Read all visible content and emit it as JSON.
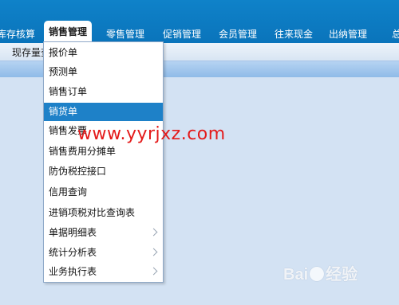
{
  "topnav": {
    "items": [
      "库存核算",
      "销售管理",
      "零售管理",
      "促销管理",
      "会员管理",
      "往来现金",
      "出纳管理",
      "总"
    ],
    "active": "销售管理"
  },
  "subbar": {
    "tab": "现存量查"
  },
  "menu": {
    "items": [
      {
        "label": "报价单"
      },
      {
        "label": "预测单"
      },
      {
        "label": "销售订单"
      },
      {
        "label": "销货单",
        "highlighted": true
      },
      {
        "label": "销售发票"
      },
      {
        "label": "销售费用分摊单"
      },
      {
        "label": "防伪税控接口"
      },
      {
        "label": "信用查询"
      },
      {
        "label": "进销项税对比查询表"
      },
      {
        "label": "单据明细表",
        "submenu": true
      },
      {
        "label": "统计分析表",
        "submenu": true
      },
      {
        "label": "业务执行表",
        "submenu": true
      }
    ]
  },
  "watermark": {
    "text": "www.yyrjxz.com",
    "color": "#e41a1a"
  },
  "logo": {
    "text_left": "Bai",
    "text_right": "经验"
  },
  "colors": {
    "nav_bg": "#0a74bb",
    "highlight": "#1e81c8",
    "page_bg": "#d3e2f3"
  }
}
